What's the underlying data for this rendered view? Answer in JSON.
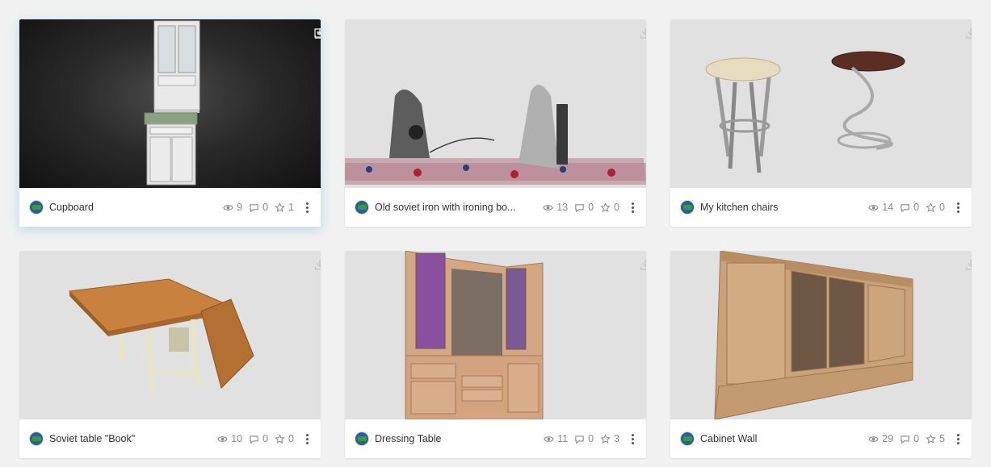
{
  "models": [
    {
      "title": "Cupboard",
      "views": "9",
      "comments": "0",
      "likes": "1",
      "thumb": "cupboard",
      "dark": true,
      "icons": [
        "film-icon",
        "download-icon"
      ]
    },
    {
      "title": "Old soviet iron with ironing bo...",
      "views": "13",
      "comments": "0",
      "likes": "0",
      "thumb": "iron",
      "dark": false,
      "icons": [
        "download-icon"
      ]
    },
    {
      "title": "My kitchen chairs",
      "views": "14",
      "comments": "0",
      "likes": "0",
      "thumb": "stools",
      "dark": false,
      "icons": [
        "download-icon"
      ]
    },
    {
      "title": "Soviet table \"Book\"",
      "views": "10",
      "comments": "0",
      "likes": "0",
      "thumb": "table",
      "dark": false,
      "icons": [
        "download-icon"
      ]
    },
    {
      "title": "Dressing Table",
      "views": "11",
      "comments": "0",
      "likes": "3",
      "thumb": "dresser",
      "dark": false,
      "icons": [
        "download-icon"
      ]
    },
    {
      "title": "Cabinet Wall",
      "views": "29",
      "comments": "0",
      "likes": "5",
      "thumb": "cabinet",
      "dark": false,
      "icons": [
        "download-icon"
      ]
    }
  ],
  "colors": {
    "background": "#f1f1f1",
    "card": "#ffffff",
    "text": "#333333",
    "muted": "#8a8a8a",
    "highlight_shadow": "#78bedc"
  }
}
